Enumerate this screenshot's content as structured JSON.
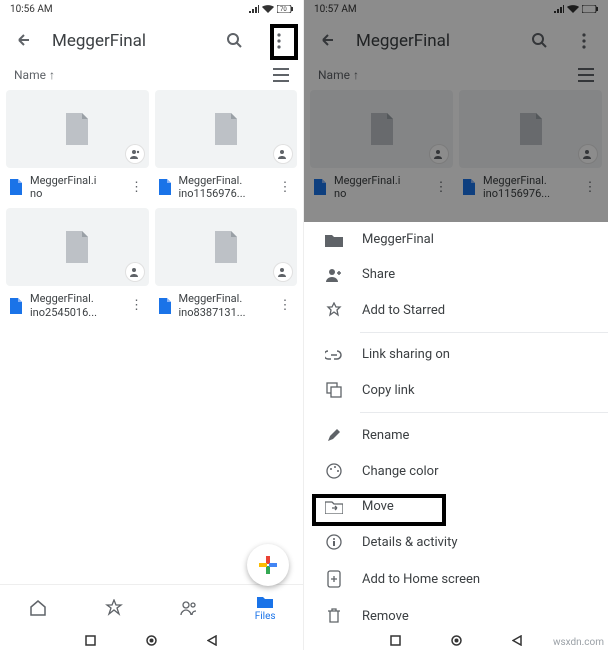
{
  "left": {
    "time": "10:56 AM",
    "title": "MeggerFinal",
    "sort": "Name ↑",
    "files": [
      {
        "l1": "MeggerFinal.i",
        "l2": "no"
      },
      {
        "l1": "MeggerFinal.",
        "l2": "ino1156976..."
      },
      {
        "l1": "MeggerFinal.",
        "l2": "ino2545016..."
      },
      {
        "l1": "MeggerFinal.",
        "l2": "ino8387131..."
      }
    ],
    "tab_files": "Files"
  },
  "right": {
    "time": "10:57 AM",
    "title": "MeggerFinal",
    "sort": "Name ↑",
    "files": [
      {
        "l1": "MeggerFinal.i",
        "l2": "no"
      },
      {
        "l1": "MeggerFinal.",
        "l2": "ino1156976..."
      }
    ],
    "sheet": {
      "folder": "MeggerFinal",
      "share": "Share",
      "star": "Add to Starred",
      "link": "Link sharing on",
      "copy": "Copy link",
      "rename": "Rename",
      "color": "Change color",
      "move": "Move",
      "details": "Details & activity",
      "home": "Add to Home screen",
      "remove": "Remove"
    }
  },
  "watermark": "wsxdn.com"
}
